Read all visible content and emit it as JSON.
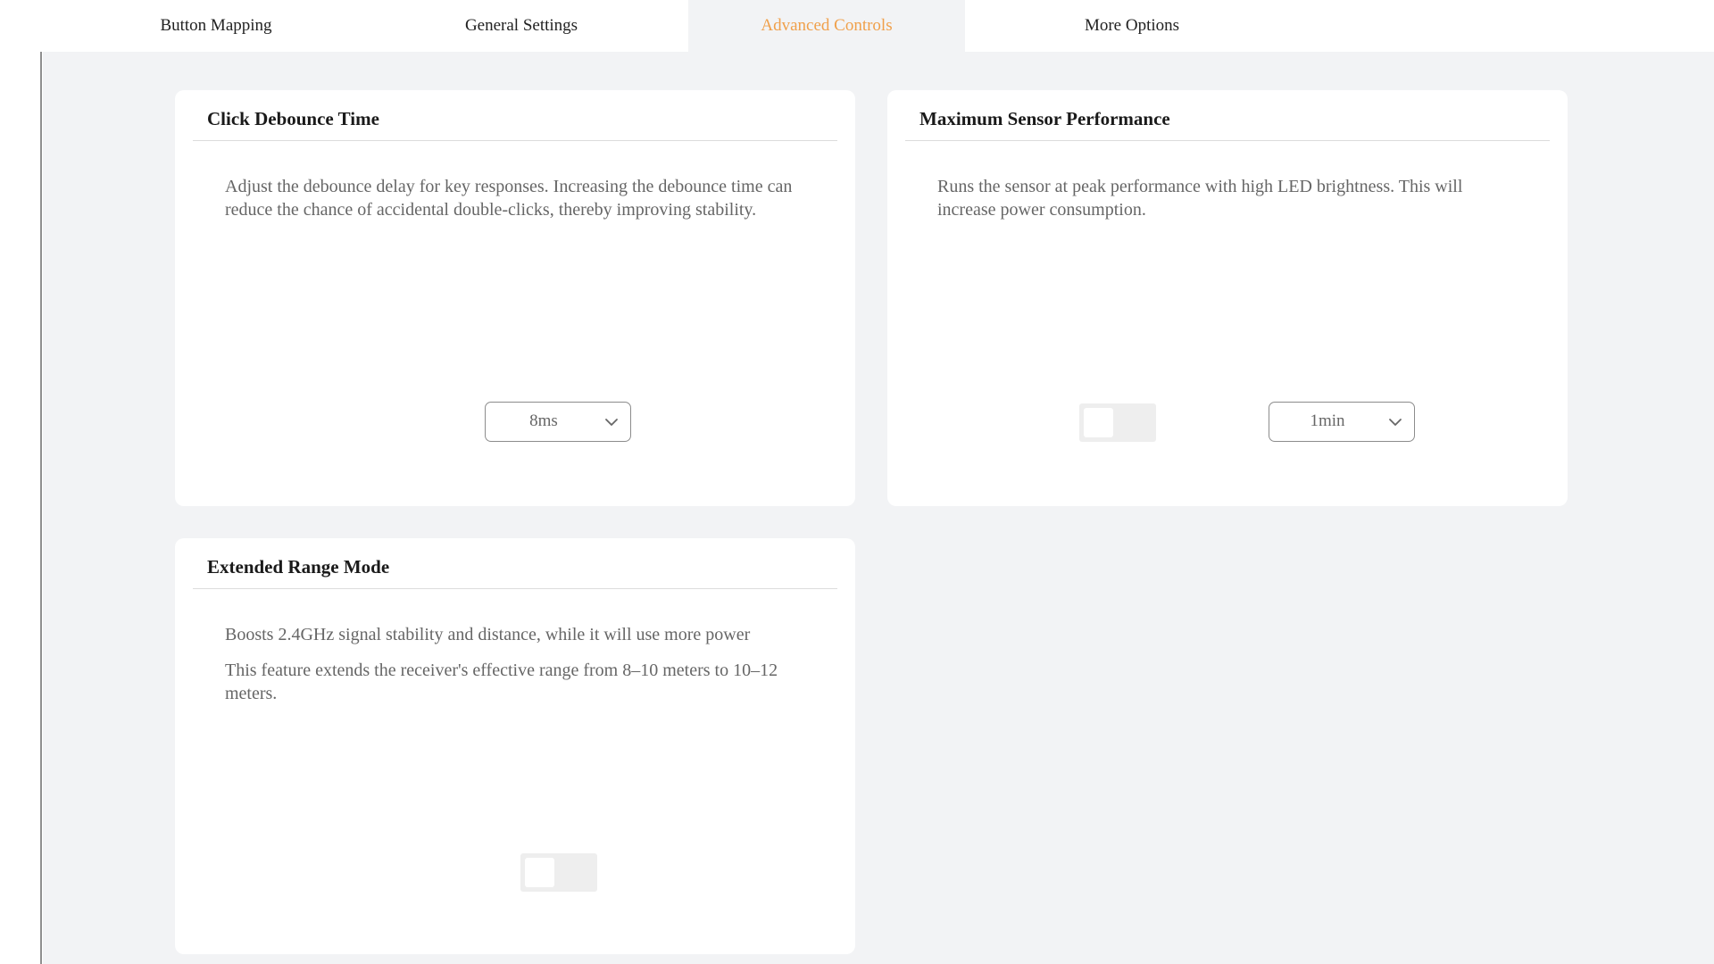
{
  "nav": {
    "tabs": [
      {
        "label": "Button Mapping"
      },
      {
        "label": "General Settings"
      },
      {
        "label": "Advanced Controls"
      },
      {
        "label": "More Options"
      }
    ],
    "active_index": 2
  },
  "colors": {
    "accent": "#f0a04b",
    "content_bg": "#f2f3f5",
    "card_bg": "#ffffff",
    "text_muted": "#666666",
    "toggle_off": "#eeeeee"
  },
  "cards": {
    "debounce": {
      "title": "Click Debounce Time",
      "description": "Adjust the debounce delay for key responses. Increasing the debounce time can reduce the chance of accidental double-clicks, thereby improving stability.",
      "dropdown": {
        "value": "8ms",
        "icon": "chevron-down-icon"
      }
    },
    "sensor": {
      "title": "Maximum Sensor Performance",
      "description": "Runs the sensor at peak performance with high LED brightness. This will increase power consumption.",
      "toggle": {
        "on": false
      },
      "dropdown": {
        "value": "1min",
        "icon": "chevron-down-icon"
      }
    },
    "range": {
      "title": "Extended Range Mode",
      "description1": "Boosts 2.4GHz signal stability and distance, while it will use more power",
      "description2": "This feature extends the receiver's effective range from 8–10 meters to 10–12 meters.",
      "toggle": {
        "on": false
      }
    }
  }
}
